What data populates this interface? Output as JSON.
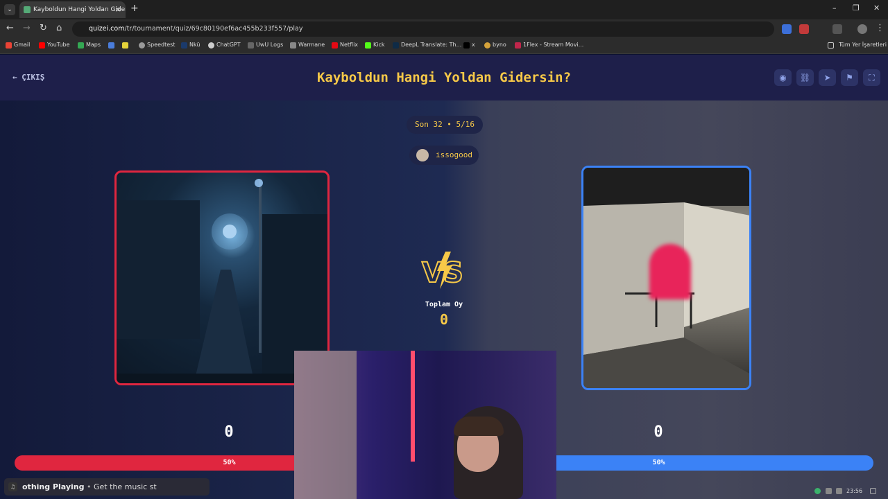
{
  "browser": {
    "tab_title": "Kayboldun Hangi Yoldan Gidersin?",
    "url_host": "quizei.com",
    "url_path": "/tr/tournament/quiz/69c80190ef6ac455b233f557/play",
    "bookmarks": [
      "Gmail",
      "YouTube",
      "Maps",
      "Speedtest",
      "Nkü",
      "ChatGPT",
      "UwU Logs",
      "Warmane",
      "Netflix",
      "Kick",
      "DeepL Translate: Th...",
      "x",
      "byno",
      "1Flex - Stream Movi..."
    ],
    "all_bookmarks": "Tüm Yer İşaretleri"
  },
  "header": {
    "exit_label": "ÇIKIŞ",
    "title": "Kayboldun Hangi Yoldan Gidersin?"
  },
  "round": {
    "label": "Son 32 • 5/16",
    "creator": "issogood"
  },
  "vs": {
    "total_label": "Toplam Oy",
    "total_value": "0"
  },
  "left": {
    "score": "0",
    "percent": "50%",
    "percent_value": 50,
    "color": "#e0263f"
  },
  "right": {
    "score": "0",
    "percent": "50%",
    "percent_value": 50,
    "color": "#3b82f6"
  },
  "overlay": {
    "music_status": "othing Playing",
    "music_hint": "Get the music st"
  },
  "taskbar": {
    "time": "23:56"
  },
  "colors": {
    "accent": "#f7c948",
    "header_bg": "#1e1f4a"
  }
}
